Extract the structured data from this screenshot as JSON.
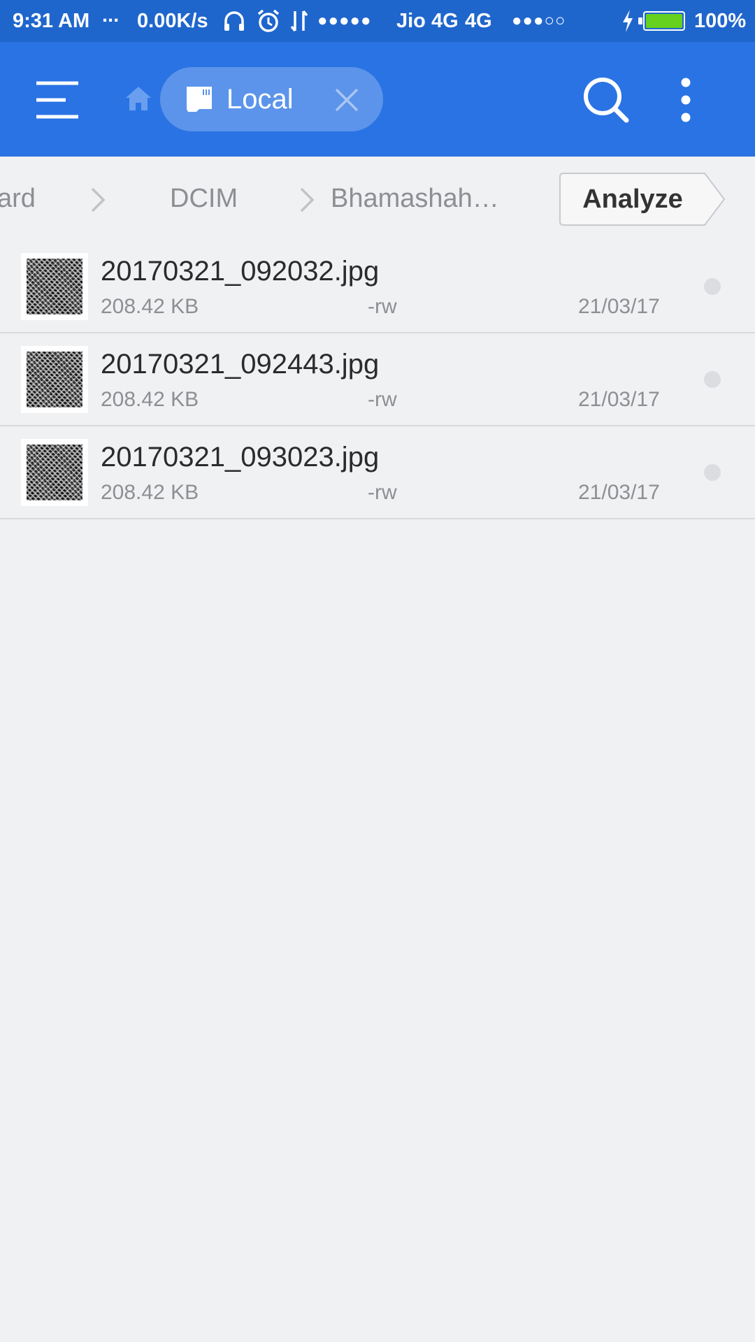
{
  "status_bar": {
    "time": "9:31 AM",
    "dots": "...",
    "speed": "0.00K/s",
    "signal1": "●●●●●",
    "carrier": "Jio 4G",
    "network": "4G",
    "signal2": "●●●○○",
    "battery": "100%",
    "battery_level": 1.0,
    "battery_color": "#66d11f",
    "icons": [
      "headphones-icon",
      "alarm-icon",
      "data-transfer-icon",
      "charging-icon",
      "battery-icon"
    ]
  },
  "toolbar": {
    "background": "#2a73e4",
    "tab_label": "Local",
    "icons": [
      "menu-icon",
      "home-icon",
      "sd-card-icon",
      "close-icon",
      "search-icon",
      "more-vert-icon"
    ]
  },
  "breadcrumb": {
    "items": [
      "ard",
      "DCIM",
      "Bhamashah…"
    ],
    "analyze_label": "Analyze"
  },
  "files": [
    {
      "name": "20170321_092032.jpg",
      "size": "208.42 KB",
      "perm": "-rw",
      "date": "21/03/17"
    },
    {
      "name": "20170321_092443.jpg",
      "size": "208.42 KB",
      "perm": "-rw",
      "date": "21/03/17"
    },
    {
      "name": "20170321_093023.jpg",
      "size": "208.42 KB",
      "perm": "-rw",
      "date": "21/03/17"
    }
  ]
}
